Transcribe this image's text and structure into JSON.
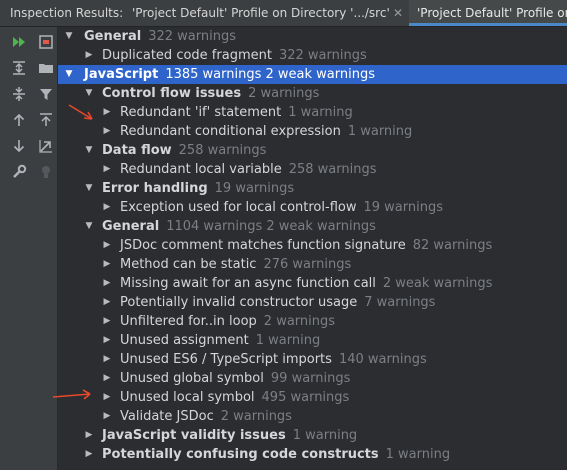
{
  "window": {
    "title": "Inspection Results:",
    "tabs": [
      {
        "label": "'Project Default' Profile on Directory '.../src'",
        "close": "✕"
      },
      {
        "label": "'Project Default' Profile on"
      }
    ]
  },
  "toolbar": {
    "icons": [
      "rerun-icon",
      "export-icon",
      "expand-all-icon",
      "group-by-directory-icon",
      "collapse-all-icon",
      "filter-icon",
      "previous-icon",
      "autoscroll-icon",
      "next-icon",
      "open-source-icon",
      "settings-wrench-icon",
      "lightbulb-icon"
    ]
  },
  "tree": [
    {
      "level": 0,
      "expanded": true,
      "bold": true,
      "label": "General",
      "count": "322 warnings"
    },
    {
      "level": 1,
      "expanded": false,
      "bold": false,
      "label": "Duplicated code fragment",
      "count": "322 warnings"
    },
    {
      "level": 0,
      "expanded": true,
      "bold": true,
      "selected": true,
      "label": "JavaScript",
      "count": "1385 warnings 2 weak warnings"
    },
    {
      "level": 1,
      "expanded": true,
      "bold": true,
      "label": "Control flow issues",
      "count": "2 warnings"
    },
    {
      "level": 2,
      "expanded": false,
      "bold": false,
      "label": "Redundant 'if' statement",
      "count": "1 warning"
    },
    {
      "level": 2,
      "expanded": false,
      "bold": false,
      "label": "Redundant conditional expression",
      "count": "1 warning"
    },
    {
      "level": 1,
      "expanded": true,
      "bold": true,
      "label": "Data flow",
      "count": "258 warnings"
    },
    {
      "level": 2,
      "expanded": false,
      "bold": false,
      "label": "Redundant local variable",
      "count": "258 warnings"
    },
    {
      "level": 1,
      "expanded": true,
      "bold": true,
      "label": "Error handling",
      "count": "19 warnings"
    },
    {
      "level": 2,
      "expanded": false,
      "bold": false,
      "label": "Exception used for local control-flow",
      "count": "19 warnings"
    },
    {
      "level": 1,
      "expanded": true,
      "bold": true,
      "label": "General",
      "count": "1104 warnings 2 weak warnings"
    },
    {
      "level": 2,
      "expanded": false,
      "bold": false,
      "label": "JSDoc comment matches function signature",
      "count": "82 warnings"
    },
    {
      "level": 2,
      "expanded": false,
      "bold": false,
      "label": "Method can be static",
      "count": "276 warnings"
    },
    {
      "level": 2,
      "expanded": false,
      "bold": false,
      "label": "Missing await for an async function call",
      "count": "2 weak warnings"
    },
    {
      "level": 2,
      "expanded": false,
      "bold": false,
      "label": "Potentially invalid constructor usage",
      "count": "7 warnings"
    },
    {
      "level": 2,
      "expanded": false,
      "bold": false,
      "label": "Unfiltered for..in loop",
      "count": "2 warnings"
    },
    {
      "level": 2,
      "expanded": false,
      "bold": false,
      "label": "Unused assignment",
      "count": "1 warning"
    },
    {
      "level": 2,
      "expanded": false,
      "bold": false,
      "label": "Unused ES6 / TypeScript imports",
      "count": "140 warnings"
    },
    {
      "level": 2,
      "expanded": false,
      "bold": false,
      "label": "Unused global symbol",
      "count": "99 warnings"
    },
    {
      "level": 2,
      "expanded": false,
      "bold": false,
      "label": "Unused local symbol",
      "count": "495 warnings"
    },
    {
      "level": 2,
      "expanded": false,
      "bold": false,
      "label": "Validate JSDoc",
      "count": "2 warnings"
    },
    {
      "level": 1,
      "expanded": false,
      "bold": true,
      "label": "JavaScript validity issues",
      "count": "1 warning"
    },
    {
      "level": 1,
      "expanded": false,
      "bold": true,
      "label": "Potentially confusing code constructs",
      "count": "1 warning"
    }
  ],
  "colors": {
    "selection": "#2f65ca",
    "annotation_arrow": "#e8492c",
    "run_green": "#4fb34f",
    "muted": "#7c7f84"
  }
}
